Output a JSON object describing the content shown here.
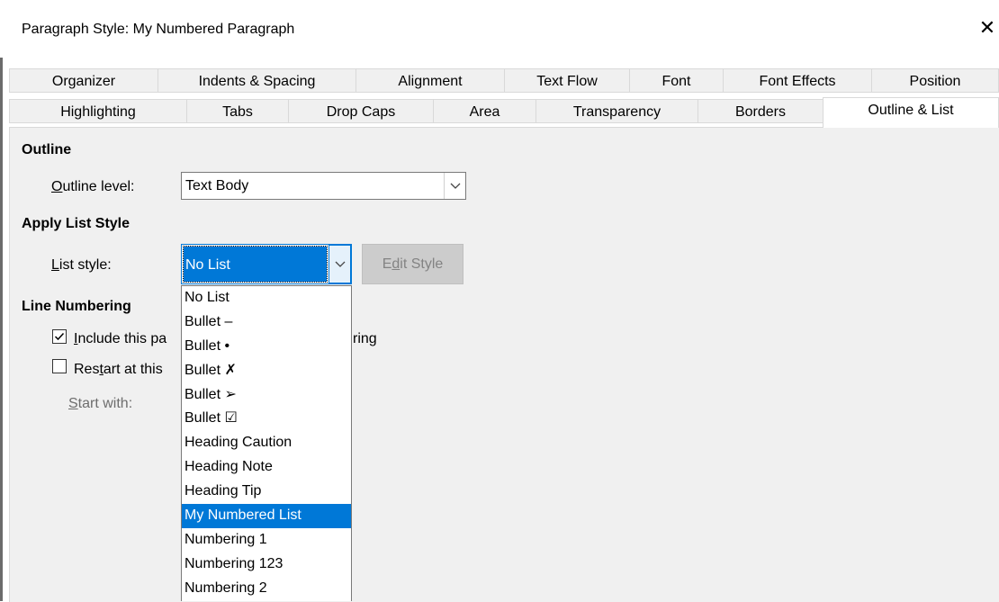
{
  "window": {
    "title": "Paragraph Style: My Numbered Paragraph",
    "close_glyph": "✕"
  },
  "tabs_row1": [
    "Organizer",
    "Indents & Spacing",
    "Alignment",
    "Text Flow",
    "Font",
    "Font Effects",
    "Position"
  ],
  "tabs_row2": [
    "Highlighting",
    "Tabs",
    "Drop Caps",
    "Area",
    "Transparency",
    "Borders",
    "Outline & List"
  ],
  "active_tab": "Outline & List",
  "outline": {
    "section_title": "Outline",
    "level_label_u": "O",
    "level_label_rest": "utline level:",
    "level_value": "Text Body"
  },
  "list_style": {
    "section_title": "Apply List Style",
    "label_u": "L",
    "label_rest": "ist style:",
    "value": "No List",
    "edit_button_pre": "E",
    "edit_button_u": "d",
    "edit_button_post": "it Style"
  },
  "line_numbering": {
    "section_title": "Line Numbering",
    "include_u": "I",
    "include_visible": "nclude this pa",
    "include_tail": "ring",
    "include_checked": true,
    "restart_pre": "Res",
    "restart_u": "t",
    "restart_visible": "art at this",
    "restart_checked": false,
    "start_with_u": "S",
    "start_with_rest": "tart with:"
  },
  "dropdown": {
    "items": [
      "No List",
      "Bullet –",
      "Bullet •",
      "Bullet ✗",
      "Bullet ➢",
      "Bullet ☑",
      "Heading Caution",
      "Heading Note",
      "Heading Tip",
      "My Numbered List",
      "Numbering 1",
      "Numbering 123",
      "Numbering 2"
    ],
    "selected_index": 9
  },
  "colors": {
    "accent": "#0078d7",
    "panel": "#f0f0f0"
  }
}
